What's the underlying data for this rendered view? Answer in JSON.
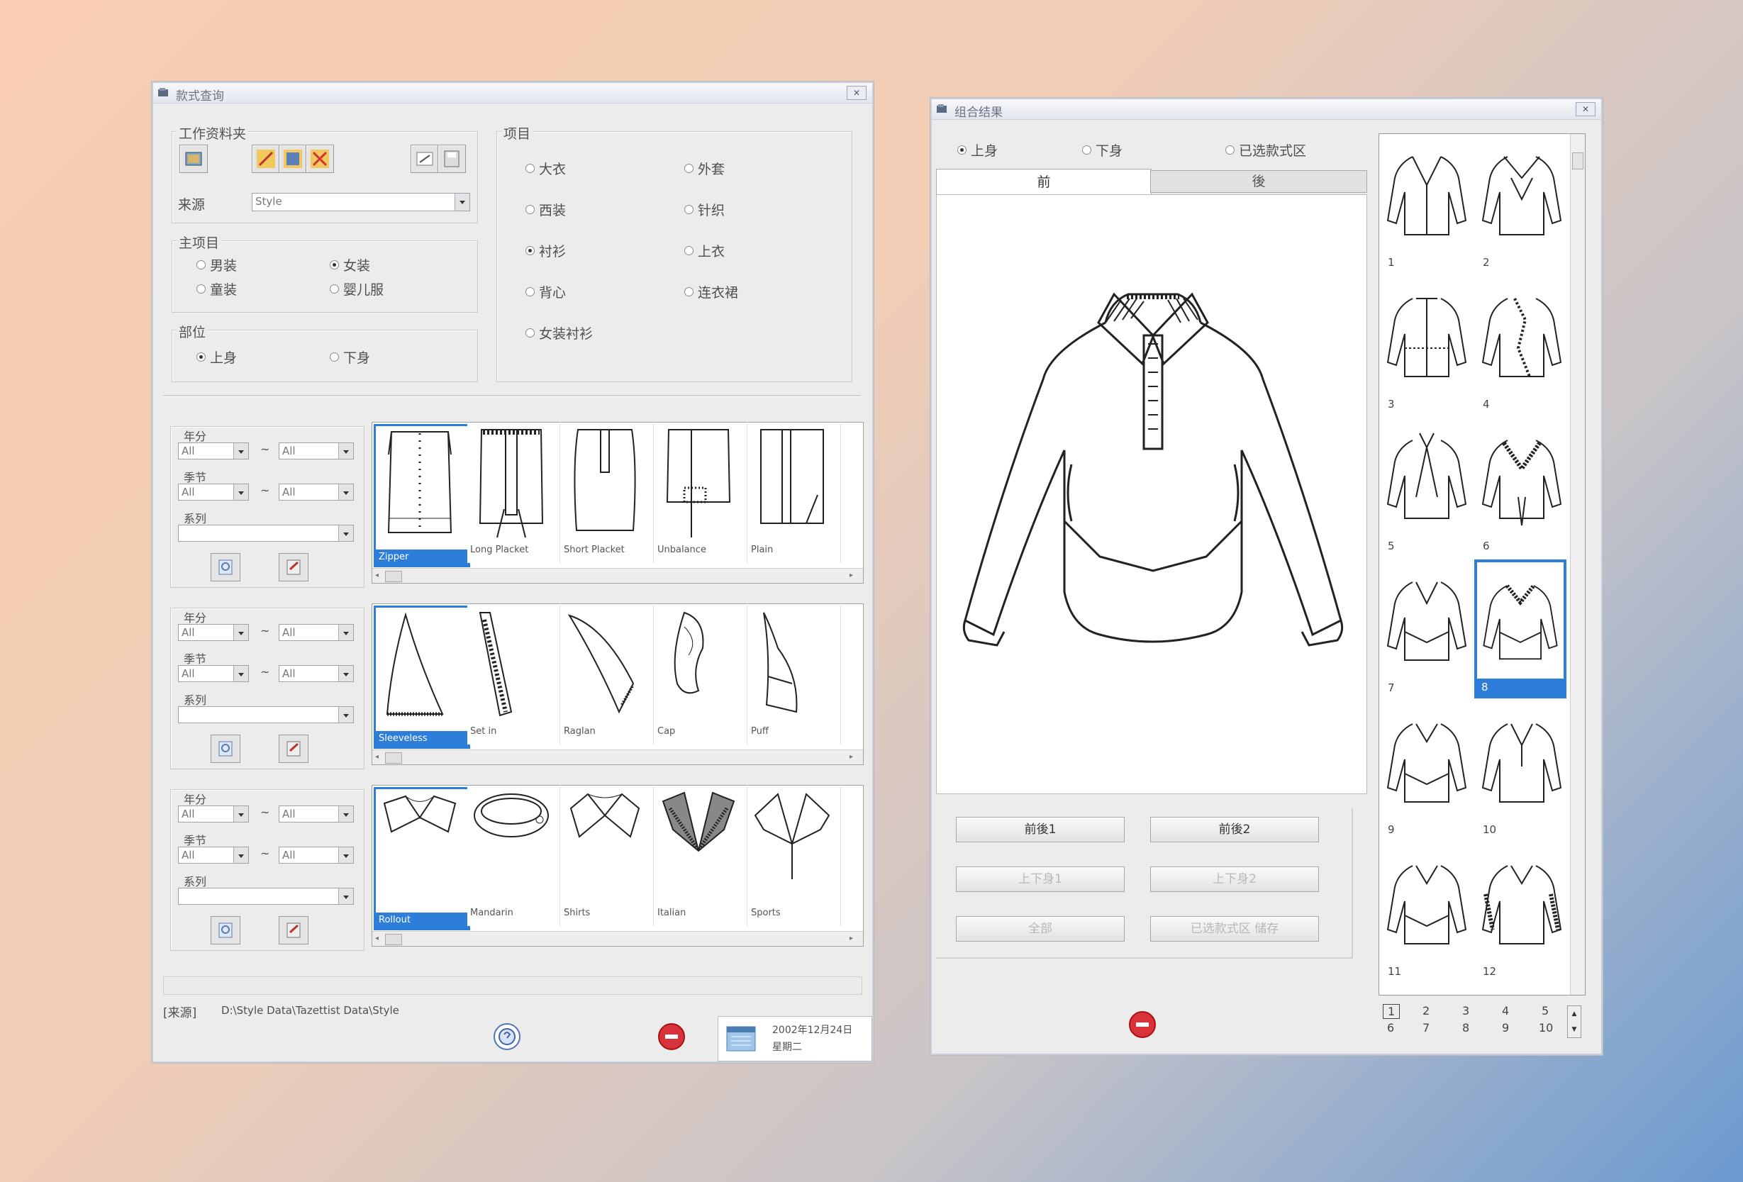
{
  "left_window": {
    "title": "款式查询",
    "folder_group": {
      "label": "工作资料夹",
      "source_label": "来源",
      "source_value": "Style"
    },
    "main_category": {
      "label": "主项目",
      "options": [
        "男装",
        "女装",
        "童装",
        "婴儿服"
      ],
      "selected": "女装"
    },
    "part_group": {
      "label": "部位",
      "options": [
        "上身",
        "下身"
      ],
      "selected": "上身"
    },
    "item_group": {
      "label": "项目",
      "options": [
        "大衣",
        "外套",
        "西装",
        "针织",
        "衬衫",
        "上衣",
        "背心",
        "连衣裙",
        "女装衬衫"
      ],
      "selected": "衬衫"
    },
    "filters": {
      "year_label": "年分",
      "season_label": "季节",
      "series_label": "系列",
      "all": "All",
      "dash": "~"
    },
    "strip1": [
      "Zipper",
      "Long Placket",
      "Short Placket",
      "Unbalance",
      "Plain"
    ],
    "strip2": [
      "Sleeveless",
      "Set in",
      "Raglan",
      "Cap",
      "Puff"
    ],
    "strip3": [
      "Rollout",
      "Mandarin",
      "Shirts",
      "Italian",
      "Sports"
    ],
    "path_label": "[来源]",
    "path_value": "D:\\Style Data\\Tazettist Data\\Style",
    "date": "2002年12月24日",
    "weekday": "星期二"
  },
  "right_window": {
    "title": "组合结果",
    "radios": [
      "上身",
      "下身",
      "已选款式区"
    ],
    "radio_selected": "上身",
    "tabs": [
      "前",
      "後"
    ],
    "buttons": [
      "前後1",
      "前後2",
      "上下身1",
      "上下身2",
      "全部",
      "已选款式区 储存"
    ],
    "gallery_numbers": [
      "1",
      "2",
      "3",
      "4",
      "5",
      "6",
      "7",
      "8",
      "9",
      "10",
      "11",
      "12"
    ],
    "gallery_selected": "8",
    "pages_top": [
      "1",
      "2",
      "3",
      "4",
      "5"
    ],
    "pages_bottom": [
      "6",
      "7",
      "8",
      "9",
      "10"
    ],
    "current_page": "1"
  },
  "colors": {
    "selection": "#2d7ddb",
    "window_bg": "#ececec"
  }
}
